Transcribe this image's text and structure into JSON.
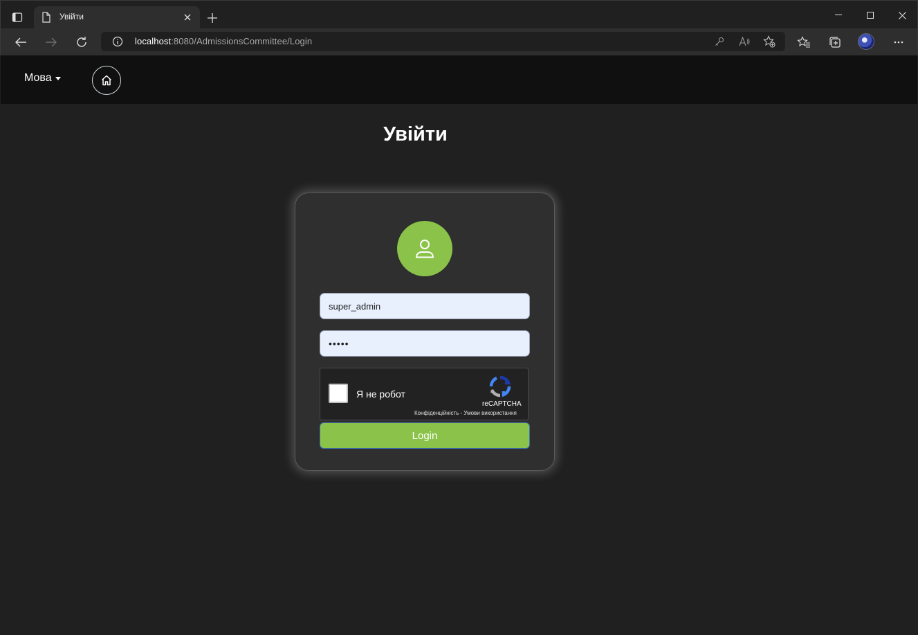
{
  "browser": {
    "tab_title": "Увійти",
    "address_host": "localhost",
    "address_rest": ":8080/AdmissionsCommittee/Login"
  },
  "nav": {
    "language_label": "Мова"
  },
  "page": {
    "title": "Увійти"
  },
  "login_form": {
    "username_value": "super_admin",
    "password_value": "•••••",
    "captcha_label": "Я не робот",
    "captcha_brand": "reCAPTCHA",
    "captcha_links": "Конфіденційність - Умови використання",
    "submit_label": "Login"
  },
  "colors": {
    "accent_green": "#8bc34a",
    "page_background": "#202020",
    "navbar_background": "#101010",
    "card_background": "#2f2f2f"
  },
  "icons": {
    "home": "home-icon",
    "user": "user-icon",
    "recaptcha": "recaptcha-logo-icon"
  }
}
